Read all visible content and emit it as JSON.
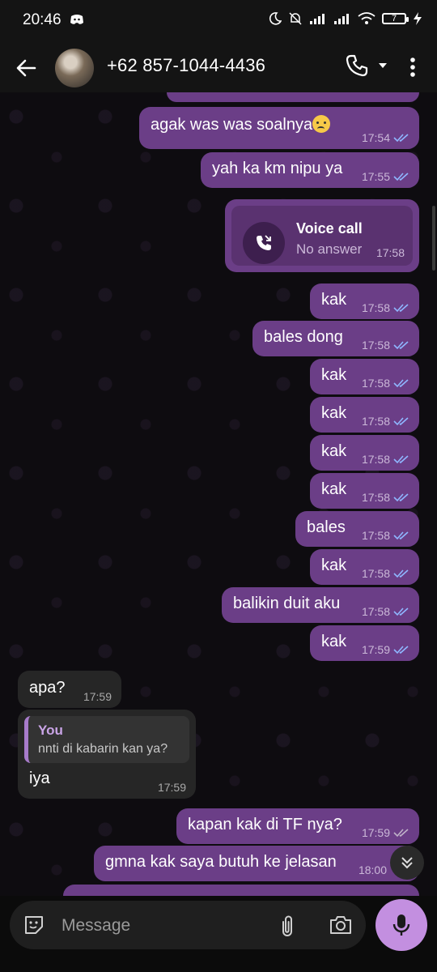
{
  "status_bar": {
    "time": "20:46",
    "battery": "7"
  },
  "header": {
    "contact": "+62 857-1044-4436"
  },
  "messages": [
    {
      "text": "agak was was soalnya",
      "time": "17:54"
    },
    {
      "text": "yah ka km nipu ya",
      "time": "17:55"
    },
    {
      "text": "kak",
      "time": "17:58"
    },
    {
      "text": "bales dong",
      "time": "17:58"
    },
    {
      "text": "kak",
      "time": "17:58"
    },
    {
      "text": "kak",
      "time": "17:58"
    },
    {
      "text": "kak",
      "time": "17:58"
    },
    {
      "text": "kak",
      "time": "17:58"
    },
    {
      "text": "bales",
      "time": "17:58"
    },
    {
      "text": "kak",
      "time": "17:58"
    },
    {
      "text": "balikin duit aku",
      "time": "17:58"
    },
    {
      "text": "kak",
      "time": "17:59"
    },
    {
      "text": "apa?",
      "time": "17:59"
    },
    {
      "text": "iya",
      "time": "17:59"
    },
    {
      "text": "kapan kak di TF nya?",
      "time": "17:59"
    },
    {
      "text": "gmna kak saya butuh ke jelasan",
      "time": "18:00"
    }
  ],
  "voice_call": {
    "title": "Voice call",
    "status": "No answer",
    "time": "17:58"
  },
  "quote": {
    "author": "You",
    "text": "nnti di kabarin kan ya?"
  },
  "input": {
    "placeholder": "Message"
  },
  "colors": {
    "outgoing": "#6b3e87",
    "incoming": "#262626",
    "accent": "#c38fe0",
    "ticks": "#8fb7ff"
  }
}
